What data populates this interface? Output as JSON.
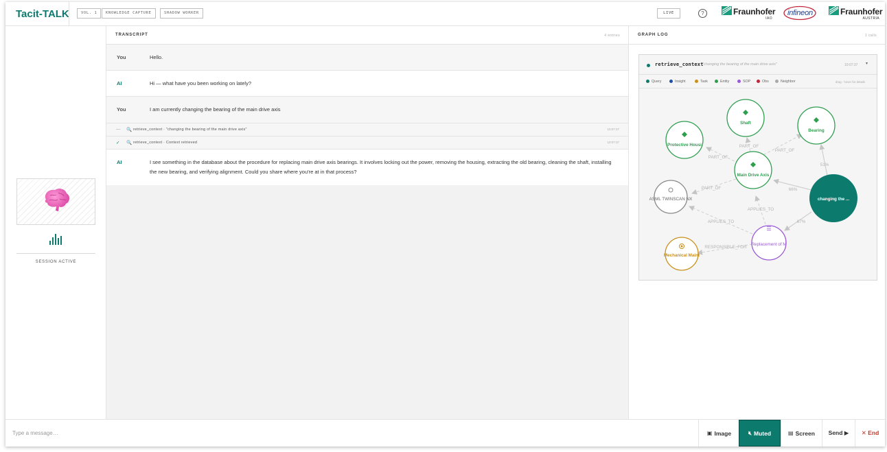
{
  "header": {
    "brand": "Tacit-TALK",
    "tags": [
      "VOL. 1",
      "KNOWLEDGE CAPTURE",
      "SHADOW WORKER"
    ],
    "live_label": "LIVE",
    "help_icon": "help-circle-icon",
    "logos": [
      {
        "name": "Fraunhofer",
        "sub": "IAO"
      },
      {
        "name": "infineon"
      },
      {
        "name": "Fraunhofer",
        "sub": "AUSTRIA"
      }
    ]
  },
  "left": {
    "avatar_icon": "brain-icon",
    "voice_icon": "voice-activity-icon",
    "session_label": "SESSION ACTIVE"
  },
  "transcript": {
    "title": "TRANSCRIPT",
    "count": "4 entries",
    "messages": [
      {
        "speaker": "You",
        "text": "Hello."
      },
      {
        "speaker": "AI",
        "text": "Hi — what have you been working on lately?"
      },
      {
        "speaker": "You",
        "text": "I am currently changing the bearing of the main drive axis"
      },
      {
        "speaker": "AI",
        "text": "I see something in the database about the procedure for replacing main drive axis bearings. It involves locking out the power, removing the housing, extracting the old bearing, cleaning the shaft, installing the new bearing, and verifying alignment. Could you share where you're at in that process?"
      }
    ],
    "tool_calls": [
      {
        "marker": "—",
        "text": "retrieve_context · \"changing the bearing of the main drive axis\"",
        "time": "10:07:37"
      },
      {
        "marker": "✓",
        "text": "retrieve_context · Context retrieved",
        "time": "10:07:37"
      }
    ]
  },
  "graph": {
    "title": "GRAPH LOG",
    "count": "1 calls",
    "card": {
      "tool": "retrieve_context",
      "query": "\"changing the bearing of the main drive axis\"",
      "time": "10:07:37",
      "caret": "▾"
    },
    "legend": [
      {
        "label": "Query",
        "color": "#0d7a6e"
      },
      {
        "label": "Insight",
        "color": "#1f4fa8"
      },
      {
        "label": "Task",
        "color": "#c8901a"
      },
      {
        "label": "Entity",
        "color": "#2e9e4f"
      },
      {
        "label": "SOP",
        "color": "#9b59d6"
      },
      {
        "label": "Obs",
        "color": "#c0253a"
      },
      {
        "label": "Neighbor",
        "color": "#aaaaaa"
      }
    ],
    "drag_hint": "drag · hover for details",
    "nodes": {
      "shaft": "Shaft",
      "bearing": "Bearing",
      "protective": "Protective Housi",
      "main_drive": "Main Drive Axis",
      "asml": "ASML TWINSCAN NX",
      "query": "changing the ...",
      "replacement": "Replacement of M",
      "mechanical": "Mechanical Maint"
    },
    "edges": {
      "shaft_main": "PART_OF",
      "bearing_main": "PART_OF",
      "protective_main": "PART_OF",
      "main_asml": "PART_OF",
      "replacement_main": "APPLIES_TO",
      "replacement_asml": "APPLIES_TO",
      "replacement_mechanical": "RESPONSIBLE_FOR",
      "query_bearing": "51%",
      "query_main": "66%",
      "query_replacement": "67%"
    }
  },
  "bottom": {
    "placeholder": "Type a message…",
    "image_label": "Image",
    "muted_label": "Muted",
    "screen_label": "Screen",
    "send_label": "Send ▶",
    "end_label": "✕ End"
  }
}
